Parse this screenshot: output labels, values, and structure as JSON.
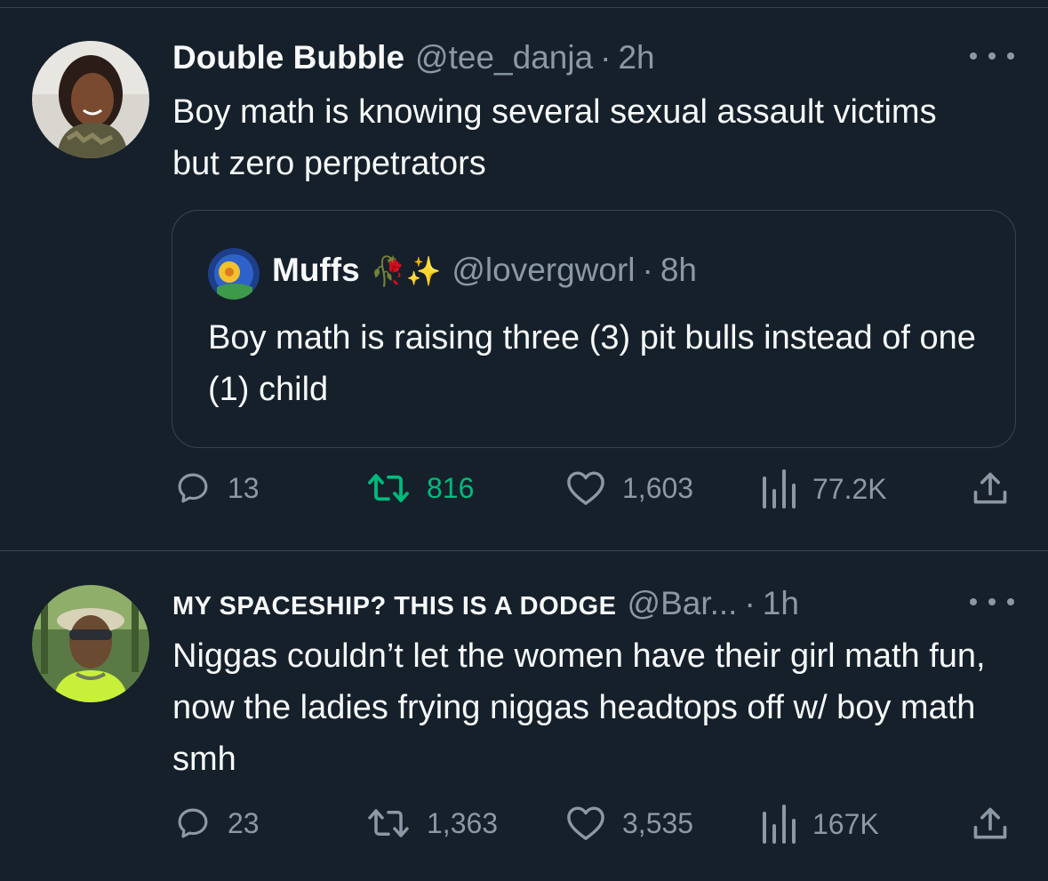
{
  "tweets": [
    {
      "author_name": "Double Bubble",
      "handle": "@tee_danja",
      "separator": "·",
      "time": "2h",
      "text": "Boy math is knowing several sexual assault victims but zero perpetrators",
      "quote": {
        "author_name": "Muffs",
        "author_emoji": "🥀✨",
        "handle": "@lovergworl",
        "separator": "·",
        "time": "8h",
        "text": "Boy math is raising three (3) pit bulls instead of one (1) child"
      },
      "replies": "13",
      "retweets": "816",
      "likes": "1,603",
      "views": "77.2K",
      "retweeted": true
    },
    {
      "author_name": "MY SPACESHIP? THIS IS A DODGE",
      "handle": "@Bar...",
      "separator": "·",
      "time": "1h",
      "text": "Niggas couldn’t let the women have their girl math fun, now the ladies frying niggas headtops off w/ boy math smh",
      "replies": "23",
      "retweets": "1,363",
      "likes": "3,535",
      "views": "167K",
      "retweeted": false
    }
  ],
  "icons": {
    "reply": "speech-bubble-icon",
    "retweet": "retweet-arrows-icon",
    "like": "heart-icon",
    "views": "bar-chart-icon",
    "share": "upload-share-icon",
    "more": "more-dots-icon"
  },
  "colors": {
    "background": "#15202b",
    "text": "#f7f9f9",
    "muted": "#8b98a5",
    "border": "#38444d",
    "retweet_active": "#00ba7c"
  }
}
